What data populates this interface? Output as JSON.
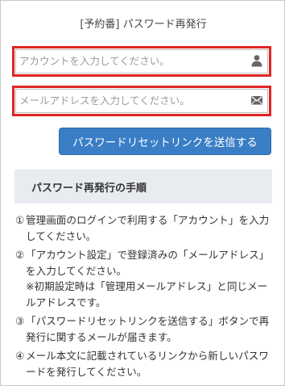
{
  "page": {
    "title": "[予約番]  パスワード再発行"
  },
  "form": {
    "account_placeholder": "アカウントを入力してください。",
    "account_icon": "person-icon",
    "email_placeholder": "メールアドレスを入力してください。",
    "email_icon": "envelope-icon",
    "submit_label": "パスワードリセットリンクを送信する",
    "accent_color": "#3a7ec6",
    "highlight_color": "#e02424"
  },
  "procedure": {
    "heading": "パスワード再発行の手順",
    "steps": [
      {
        "num": "①",
        "text": "管理画面のログインで利用する「アカウント」を入力してください。"
      },
      {
        "num": "②",
        "text": "「アカウント設定」で登録済みの「メールアドレス」を入力してください。",
        "note": "※初期設定時は「管理用メールアドレス」と同じメールアドレスです。"
      },
      {
        "num": "③",
        "text": "「パスワードリセットリンクを送信する」ボタンで再発行に関するメールが届きます。"
      },
      {
        "num": "④",
        "text": "メール本文に記載されているリンクから新しいパスワードを発行してください。"
      }
    ]
  }
}
